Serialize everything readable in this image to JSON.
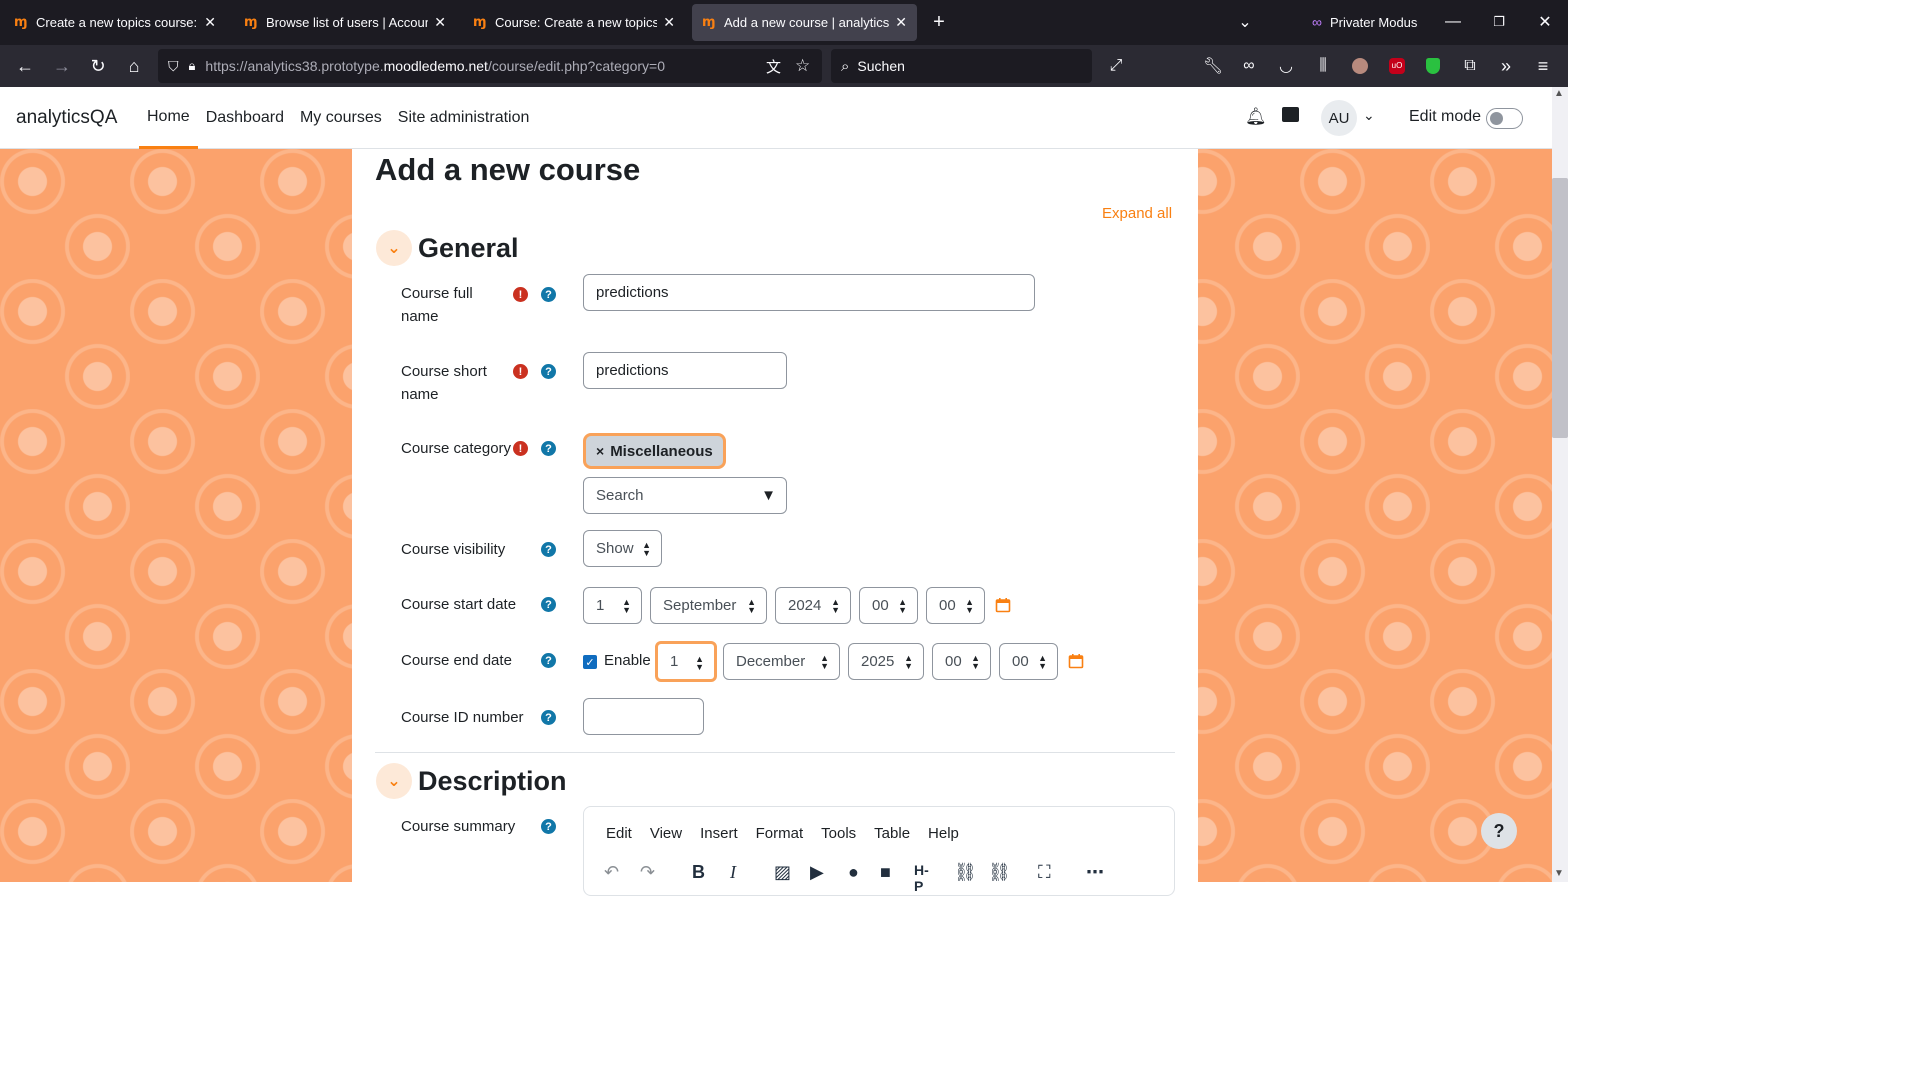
{
  "browser": {
    "tabs": [
      {
        "label": "Create a new topics course: Log",
        "active": false
      },
      {
        "label": "Browse list of users | Accounts |",
        "active": false
      },
      {
        "label": "Course: Create a new topics cou",
        "active": false
      },
      {
        "label": "Add a new course | analyticsQA",
        "active": true
      }
    ],
    "private_label": "Privater Modus",
    "url_prefix": "https://analytics38.prototype.",
    "url_host": "moodledemo.net",
    "url_path": "/course/edit.php?category=0",
    "search_placeholder": "Suchen"
  },
  "header": {
    "brand": "analyticsQA",
    "nav": [
      "Home",
      "Dashboard",
      "My courses",
      "Site administration"
    ],
    "avatar_initials": "AU",
    "edit_mode_label": "Edit mode"
  },
  "page": {
    "title": "Add a new course",
    "expand_all": "Expand all"
  },
  "general": {
    "title": "General",
    "full_name_label": "Course full name",
    "full_name_value": "predictions",
    "short_name_label": "Course short name",
    "short_name_value": "predictions",
    "category_label": "Course category",
    "category_tag": "Miscellaneous",
    "category_search_placeholder": "Search",
    "visibility_label": "Course visibility",
    "visibility_value": "Show",
    "start_date_label": "Course start date",
    "start_day": "1",
    "start_month": "September",
    "start_year": "2024",
    "start_hour": "00",
    "start_minute": "00",
    "end_date_label": "Course end date",
    "end_enable_label": "Enable",
    "end_day": "1",
    "end_month": "December",
    "end_year": "2025",
    "end_hour": "00",
    "end_minute": "00",
    "id_number_label": "Course ID number",
    "id_number_value": ""
  },
  "description": {
    "title": "Description",
    "summary_label": "Course summary",
    "editor_menu": [
      "Edit",
      "View",
      "Insert",
      "Format",
      "Tools",
      "Table",
      "Help"
    ]
  },
  "colors": {
    "accent": "#f98012",
    "required": "#ca3120",
    "help": "#1177a8"
  }
}
